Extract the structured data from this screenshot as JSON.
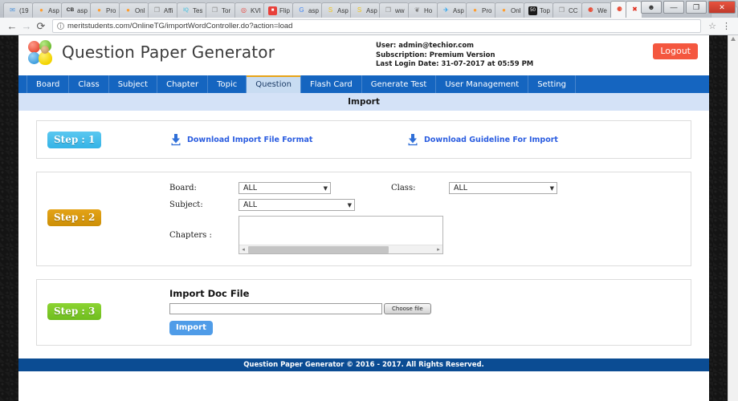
{
  "browser": {
    "tabs": [
      {
        "label": "(19",
        "icon": "mail-icon",
        "icon_glyph": "✉",
        "icon_color": "#4a90d9",
        "active": false
      },
      {
        "label": "Asp",
        "icon": "firefox-icon",
        "icon_glyph": "●",
        "icon_color": "#ff9d2e",
        "active": false
      },
      {
        "label": "asp",
        "icon": "cb-icon",
        "icon_glyph": "CB",
        "icon_color": "#2a2a2a",
        "active": false
      },
      {
        "label": "Pro",
        "icon": "firefox-icon",
        "icon_glyph": "●",
        "icon_color": "#ff9d2e",
        "active": false
      },
      {
        "label": "Onl",
        "icon": "firefox-icon",
        "icon_glyph": "●",
        "icon_color": "#ff9d2e",
        "active": false
      },
      {
        "label": "Affi",
        "icon": "page-icon",
        "icon_glyph": "❐",
        "icon_color": "#8a8a8a",
        "active": false
      },
      {
        "label": "Tes",
        "icon": "iq-icon",
        "icon_glyph": "IQ",
        "icon_color": "#63c6e0",
        "active": false
      },
      {
        "label": "Tor",
        "icon": "page-icon",
        "icon_glyph": "❐",
        "icon_color": "#8a8a8a",
        "active": false
      },
      {
        "label": "KVI",
        "icon": "opera-icon",
        "icon_glyph": "◎",
        "icon_color": "#e8403a",
        "active": false
      },
      {
        "label": "Flip",
        "icon": "flipkart-icon",
        "icon_glyph": "■",
        "icon_color": "#e8403a",
        "active": false
      },
      {
        "label": "asp",
        "icon": "google-icon",
        "icon_glyph": "G",
        "icon_color": "#4285f4",
        "active": false
      },
      {
        "label": "Asp",
        "icon": "s-icon",
        "icon_glyph": "S",
        "icon_color": "#f0c419",
        "active": false
      },
      {
        "label": "Asp",
        "icon": "s-icon",
        "icon_glyph": "S",
        "icon_color": "#f0c419",
        "active": false
      },
      {
        "label": "ww",
        "icon": "page-icon",
        "icon_glyph": "❐",
        "icon_color": "#8a8a8a",
        "active": false
      },
      {
        "label": "Ho",
        "icon": "bird-icon",
        "icon_glyph": "❦",
        "icon_color": "#7a7a7a",
        "active": false
      },
      {
        "label": "Asp",
        "icon": "twitter-icon",
        "icon_glyph": "✈",
        "icon_color": "#1da1f2",
        "active": false
      },
      {
        "label": "Pro",
        "icon": "firefox-icon",
        "icon_glyph": "●",
        "icon_color": "#ff9d2e",
        "active": false
      },
      {
        "label": "Onl",
        "icon": "firefox-icon",
        "icon_glyph": "●",
        "icon_color": "#ff9d2e",
        "active": false
      },
      {
        "label": "Top",
        "icon": "fifty-icon",
        "icon_glyph": "50",
        "icon_color": "#1a1a1a",
        "active": false
      },
      {
        "label": "CC",
        "icon": "page-icon",
        "icon_glyph": "❐",
        "icon_color": "#8a8a8a",
        "active": false
      },
      {
        "label": "We",
        "icon": "qpg-icon",
        "icon_glyph": "⚈",
        "icon_color": "#e8503a",
        "active": false
      },
      {
        "label": "",
        "icon": "qpg-icon",
        "icon_glyph": "⚈",
        "icon_color": "#e8503a",
        "active": true
      },
      {
        "label": "",
        "icon": "error-icon",
        "icon_glyph": "✖",
        "icon_color": "#e03020",
        "active": true
      }
    ],
    "window_controls": {
      "account_label": "☻",
      "minimize_label": "—",
      "maximize_label": "❐",
      "close_label": "✕"
    },
    "nav": {
      "back_label": "←",
      "forward_label": "→",
      "reload_label": "⟳",
      "info_label": "i",
      "url": "meritstudents.com/OnlineTG/importWordController.do?action=load",
      "bookmark_label": "☆",
      "menu_label": "⋮"
    }
  },
  "header": {
    "app_title": "Question Paper Generator",
    "user_line": "User:   admin@techior.com",
    "subscription_line": "Subscription: Premium Version",
    "last_login_line": "Last Login Date: 31-07-2017 at 05:59 PM",
    "logout_label": "Logout"
  },
  "mainnav": {
    "items": [
      {
        "label": "Board",
        "active": false
      },
      {
        "label": "Class",
        "active": false
      },
      {
        "label": "Subject",
        "active": false
      },
      {
        "label": "Chapter",
        "active": false
      },
      {
        "label": "Topic",
        "active": false
      },
      {
        "label": "Question",
        "active": true
      },
      {
        "label": "Flash Card",
        "active": false
      },
      {
        "label": "Generate Test",
        "active": false
      },
      {
        "label": "User Management",
        "active": false
      },
      {
        "label": "Setting",
        "active": false
      }
    ]
  },
  "page": {
    "title": "Import"
  },
  "step1": {
    "badge": "Step : 1",
    "download_format_label": "Download Import File Format",
    "download_guideline_label": "Download Guideline For Import"
  },
  "step2": {
    "badge": "Step : 2",
    "board_label": "Board:",
    "board_value": "ALL",
    "class_label": "Class:",
    "class_value": "ALL",
    "subject_label": "Subject:",
    "subject_value": "ALL",
    "chapters_label": "Chapters :",
    "chapters_items": [],
    "caret": "▼"
  },
  "step3": {
    "badge": "Step : 3",
    "section_title": "Import Doc File",
    "file_value": "",
    "choose_file_label": "Choose file",
    "import_button_label": "Import"
  },
  "footer": {
    "text": "Question Paper Generator © 2016 - 2017. All Rights Reserved."
  },
  "colors": {
    "nav_blue": "#1565c0",
    "nav_active_bg": "#c8dcf2",
    "nav_active_top": "#e8a317",
    "title_strip": "#d4e2f7",
    "footer_blue": "#0b4c93",
    "logout_red": "#f4573f",
    "step1_blue": "#34b3e6",
    "step2_gold": "#cc8f06",
    "step3_green": "#6fbd1e",
    "link_blue": "#2b5de0",
    "import_blue": "#4f9ce8"
  }
}
